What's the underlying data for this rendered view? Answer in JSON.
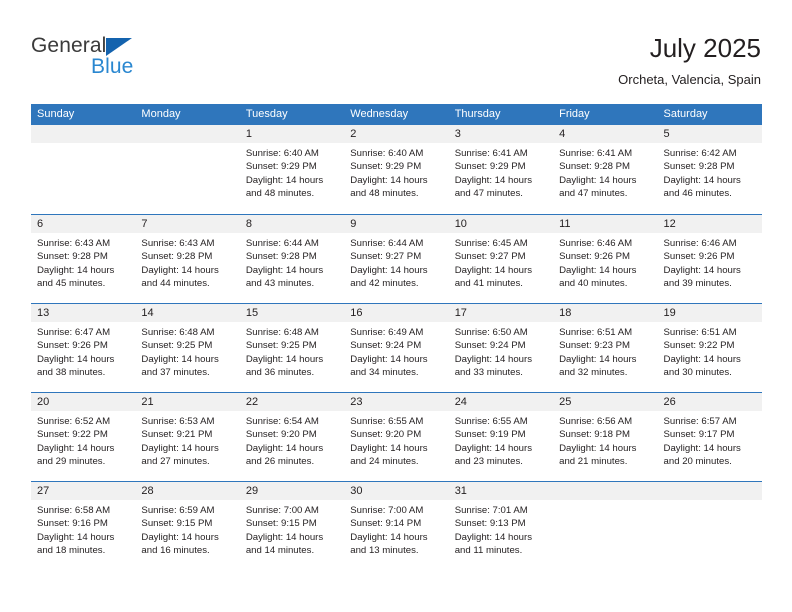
{
  "brand": {
    "name_top": "General",
    "name_bottom": "Blue",
    "triangle_color": "#1463ae",
    "blue_color": "#2a87d0"
  },
  "header": {
    "title": "July 2025",
    "subtitle": "Orcheta, Valencia, Spain"
  },
  "theme": {
    "header_blue": "#2f76bc",
    "daynum_gray": "#f1f1f1",
    "text": "#231f20"
  },
  "weekdays": [
    "Sunday",
    "Monday",
    "Tuesday",
    "Wednesday",
    "Thursday",
    "Friday",
    "Saturday"
  ],
  "weeks": [
    [
      {
        "day": "",
        "sunrise": "",
        "sunset": "",
        "daylight_line1": "",
        "daylight_line2": ""
      },
      {
        "day": "",
        "sunrise": "",
        "sunset": "",
        "daylight_line1": "",
        "daylight_line2": ""
      },
      {
        "day": "1",
        "sunrise": "Sunrise: 6:40 AM",
        "sunset": "Sunset: 9:29 PM",
        "daylight_line1": "Daylight: 14 hours",
        "daylight_line2": "and 48 minutes."
      },
      {
        "day": "2",
        "sunrise": "Sunrise: 6:40 AM",
        "sunset": "Sunset: 9:29 PM",
        "daylight_line1": "Daylight: 14 hours",
        "daylight_line2": "and 48 minutes."
      },
      {
        "day": "3",
        "sunrise": "Sunrise: 6:41 AM",
        "sunset": "Sunset: 9:29 PM",
        "daylight_line1": "Daylight: 14 hours",
        "daylight_line2": "and 47 minutes."
      },
      {
        "day": "4",
        "sunrise": "Sunrise: 6:41 AM",
        "sunset": "Sunset: 9:28 PM",
        "daylight_line1": "Daylight: 14 hours",
        "daylight_line2": "and 47 minutes."
      },
      {
        "day": "5",
        "sunrise": "Sunrise: 6:42 AM",
        "sunset": "Sunset: 9:28 PM",
        "daylight_line1": "Daylight: 14 hours",
        "daylight_line2": "and 46 minutes."
      }
    ],
    [
      {
        "day": "6",
        "sunrise": "Sunrise: 6:43 AM",
        "sunset": "Sunset: 9:28 PM",
        "daylight_line1": "Daylight: 14 hours",
        "daylight_line2": "and 45 minutes."
      },
      {
        "day": "7",
        "sunrise": "Sunrise: 6:43 AM",
        "sunset": "Sunset: 9:28 PM",
        "daylight_line1": "Daylight: 14 hours",
        "daylight_line2": "and 44 minutes."
      },
      {
        "day": "8",
        "sunrise": "Sunrise: 6:44 AM",
        "sunset": "Sunset: 9:28 PM",
        "daylight_line1": "Daylight: 14 hours",
        "daylight_line2": "and 43 minutes."
      },
      {
        "day": "9",
        "sunrise": "Sunrise: 6:44 AM",
        "sunset": "Sunset: 9:27 PM",
        "daylight_line1": "Daylight: 14 hours",
        "daylight_line2": "and 42 minutes."
      },
      {
        "day": "10",
        "sunrise": "Sunrise: 6:45 AM",
        "sunset": "Sunset: 9:27 PM",
        "daylight_line1": "Daylight: 14 hours",
        "daylight_line2": "and 41 minutes."
      },
      {
        "day": "11",
        "sunrise": "Sunrise: 6:46 AM",
        "sunset": "Sunset: 9:26 PM",
        "daylight_line1": "Daylight: 14 hours",
        "daylight_line2": "and 40 minutes."
      },
      {
        "day": "12",
        "sunrise": "Sunrise: 6:46 AM",
        "sunset": "Sunset: 9:26 PM",
        "daylight_line1": "Daylight: 14 hours",
        "daylight_line2": "and 39 minutes."
      }
    ],
    [
      {
        "day": "13",
        "sunrise": "Sunrise: 6:47 AM",
        "sunset": "Sunset: 9:26 PM",
        "daylight_line1": "Daylight: 14 hours",
        "daylight_line2": "and 38 minutes."
      },
      {
        "day": "14",
        "sunrise": "Sunrise: 6:48 AM",
        "sunset": "Sunset: 9:25 PM",
        "daylight_line1": "Daylight: 14 hours",
        "daylight_line2": "and 37 minutes."
      },
      {
        "day": "15",
        "sunrise": "Sunrise: 6:48 AM",
        "sunset": "Sunset: 9:25 PM",
        "daylight_line1": "Daylight: 14 hours",
        "daylight_line2": "and 36 minutes."
      },
      {
        "day": "16",
        "sunrise": "Sunrise: 6:49 AM",
        "sunset": "Sunset: 9:24 PM",
        "daylight_line1": "Daylight: 14 hours",
        "daylight_line2": "and 34 minutes."
      },
      {
        "day": "17",
        "sunrise": "Sunrise: 6:50 AM",
        "sunset": "Sunset: 9:24 PM",
        "daylight_line1": "Daylight: 14 hours",
        "daylight_line2": "and 33 minutes."
      },
      {
        "day": "18",
        "sunrise": "Sunrise: 6:51 AM",
        "sunset": "Sunset: 9:23 PM",
        "daylight_line1": "Daylight: 14 hours",
        "daylight_line2": "and 32 minutes."
      },
      {
        "day": "19",
        "sunrise": "Sunrise: 6:51 AM",
        "sunset": "Sunset: 9:22 PM",
        "daylight_line1": "Daylight: 14 hours",
        "daylight_line2": "and 30 minutes."
      }
    ],
    [
      {
        "day": "20",
        "sunrise": "Sunrise: 6:52 AM",
        "sunset": "Sunset: 9:22 PM",
        "daylight_line1": "Daylight: 14 hours",
        "daylight_line2": "and 29 minutes."
      },
      {
        "day": "21",
        "sunrise": "Sunrise: 6:53 AM",
        "sunset": "Sunset: 9:21 PM",
        "daylight_line1": "Daylight: 14 hours",
        "daylight_line2": "and 27 minutes."
      },
      {
        "day": "22",
        "sunrise": "Sunrise: 6:54 AM",
        "sunset": "Sunset: 9:20 PM",
        "daylight_line1": "Daylight: 14 hours",
        "daylight_line2": "and 26 minutes."
      },
      {
        "day": "23",
        "sunrise": "Sunrise: 6:55 AM",
        "sunset": "Sunset: 9:20 PM",
        "daylight_line1": "Daylight: 14 hours",
        "daylight_line2": "and 24 minutes."
      },
      {
        "day": "24",
        "sunrise": "Sunrise: 6:55 AM",
        "sunset": "Sunset: 9:19 PM",
        "daylight_line1": "Daylight: 14 hours",
        "daylight_line2": "and 23 minutes."
      },
      {
        "day": "25",
        "sunrise": "Sunrise: 6:56 AM",
        "sunset": "Sunset: 9:18 PM",
        "daylight_line1": "Daylight: 14 hours",
        "daylight_line2": "and 21 minutes."
      },
      {
        "day": "26",
        "sunrise": "Sunrise: 6:57 AM",
        "sunset": "Sunset: 9:17 PM",
        "daylight_line1": "Daylight: 14 hours",
        "daylight_line2": "and 20 minutes."
      }
    ],
    [
      {
        "day": "27",
        "sunrise": "Sunrise: 6:58 AM",
        "sunset": "Sunset: 9:16 PM",
        "daylight_line1": "Daylight: 14 hours",
        "daylight_line2": "and 18 minutes."
      },
      {
        "day": "28",
        "sunrise": "Sunrise: 6:59 AM",
        "sunset": "Sunset: 9:15 PM",
        "daylight_line1": "Daylight: 14 hours",
        "daylight_line2": "and 16 minutes."
      },
      {
        "day": "29",
        "sunrise": "Sunrise: 7:00 AM",
        "sunset": "Sunset: 9:15 PM",
        "daylight_line1": "Daylight: 14 hours",
        "daylight_line2": "and 14 minutes."
      },
      {
        "day": "30",
        "sunrise": "Sunrise: 7:00 AM",
        "sunset": "Sunset: 9:14 PM",
        "daylight_line1": "Daylight: 14 hours",
        "daylight_line2": "and 13 minutes."
      },
      {
        "day": "31",
        "sunrise": "Sunrise: 7:01 AM",
        "sunset": "Sunset: 9:13 PM",
        "daylight_line1": "Daylight: 14 hours",
        "daylight_line2": "and 11 minutes."
      },
      {
        "day": "",
        "sunrise": "",
        "sunset": "",
        "daylight_line1": "",
        "daylight_line2": ""
      },
      {
        "day": "",
        "sunrise": "",
        "sunset": "",
        "daylight_line1": "",
        "daylight_line2": ""
      }
    ]
  ]
}
